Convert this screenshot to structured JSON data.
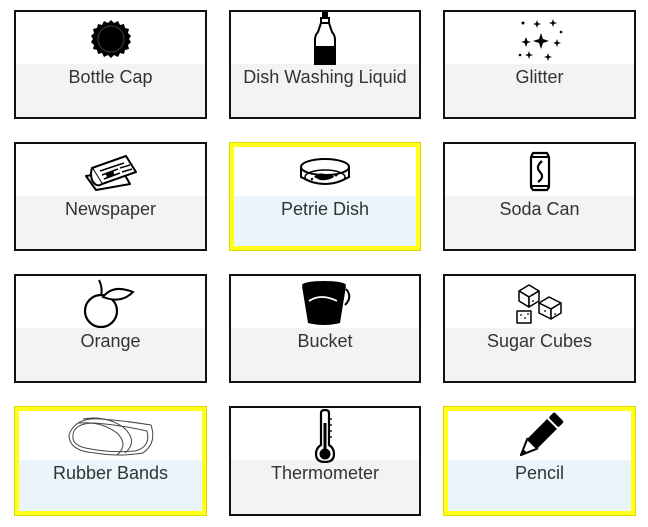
{
  "items": [
    {
      "label": "Bottle Cap",
      "icon": "bottle-cap-icon",
      "selected": false
    },
    {
      "label": "Dish Washing Liquid",
      "icon": "dish-soap-bottle-icon",
      "selected": false
    },
    {
      "label": "Glitter",
      "icon": "sparkles-icon",
      "selected": false
    },
    {
      "label": "Newspaper",
      "icon": "newspaper-icon",
      "selected": false
    },
    {
      "label": "Petrie Dish",
      "icon": "petri-dish-icon",
      "selected": true
    },
    {
      "label": "Soda Can",
      "icon": "soda-can-icon",
      "selected": false
    },
    {
      "label": "Orange",
      "icon": "orange-icon",
      "selected": false
    },
    {
      "label": "Bucket",
      "icon": "bucket-icon",
      "selected": false
    },
    {
      "label": "Sugar Cubes",
      "icon": "sugar-cubes-icon",
      "selected": false
    },
    {
      "label": "Rubber Bands",
      "icon": "rubber-bands-icon",
      "selected": true
    },
    {
      "label": "Thermometer",
      "icon": "thermometer-icon",
      "selected": false
    },
    {
      "label": "Pencil",
      "icon": "pencil-icon",
      "selected": true
    }
  ],
  "colors": {
    "selected_border": "#ffff1a",
    "selected_fill": "#e9f5fb",
    "label_fill": "#f3f3f3",
    "card_border": "#111111"
  }
}
